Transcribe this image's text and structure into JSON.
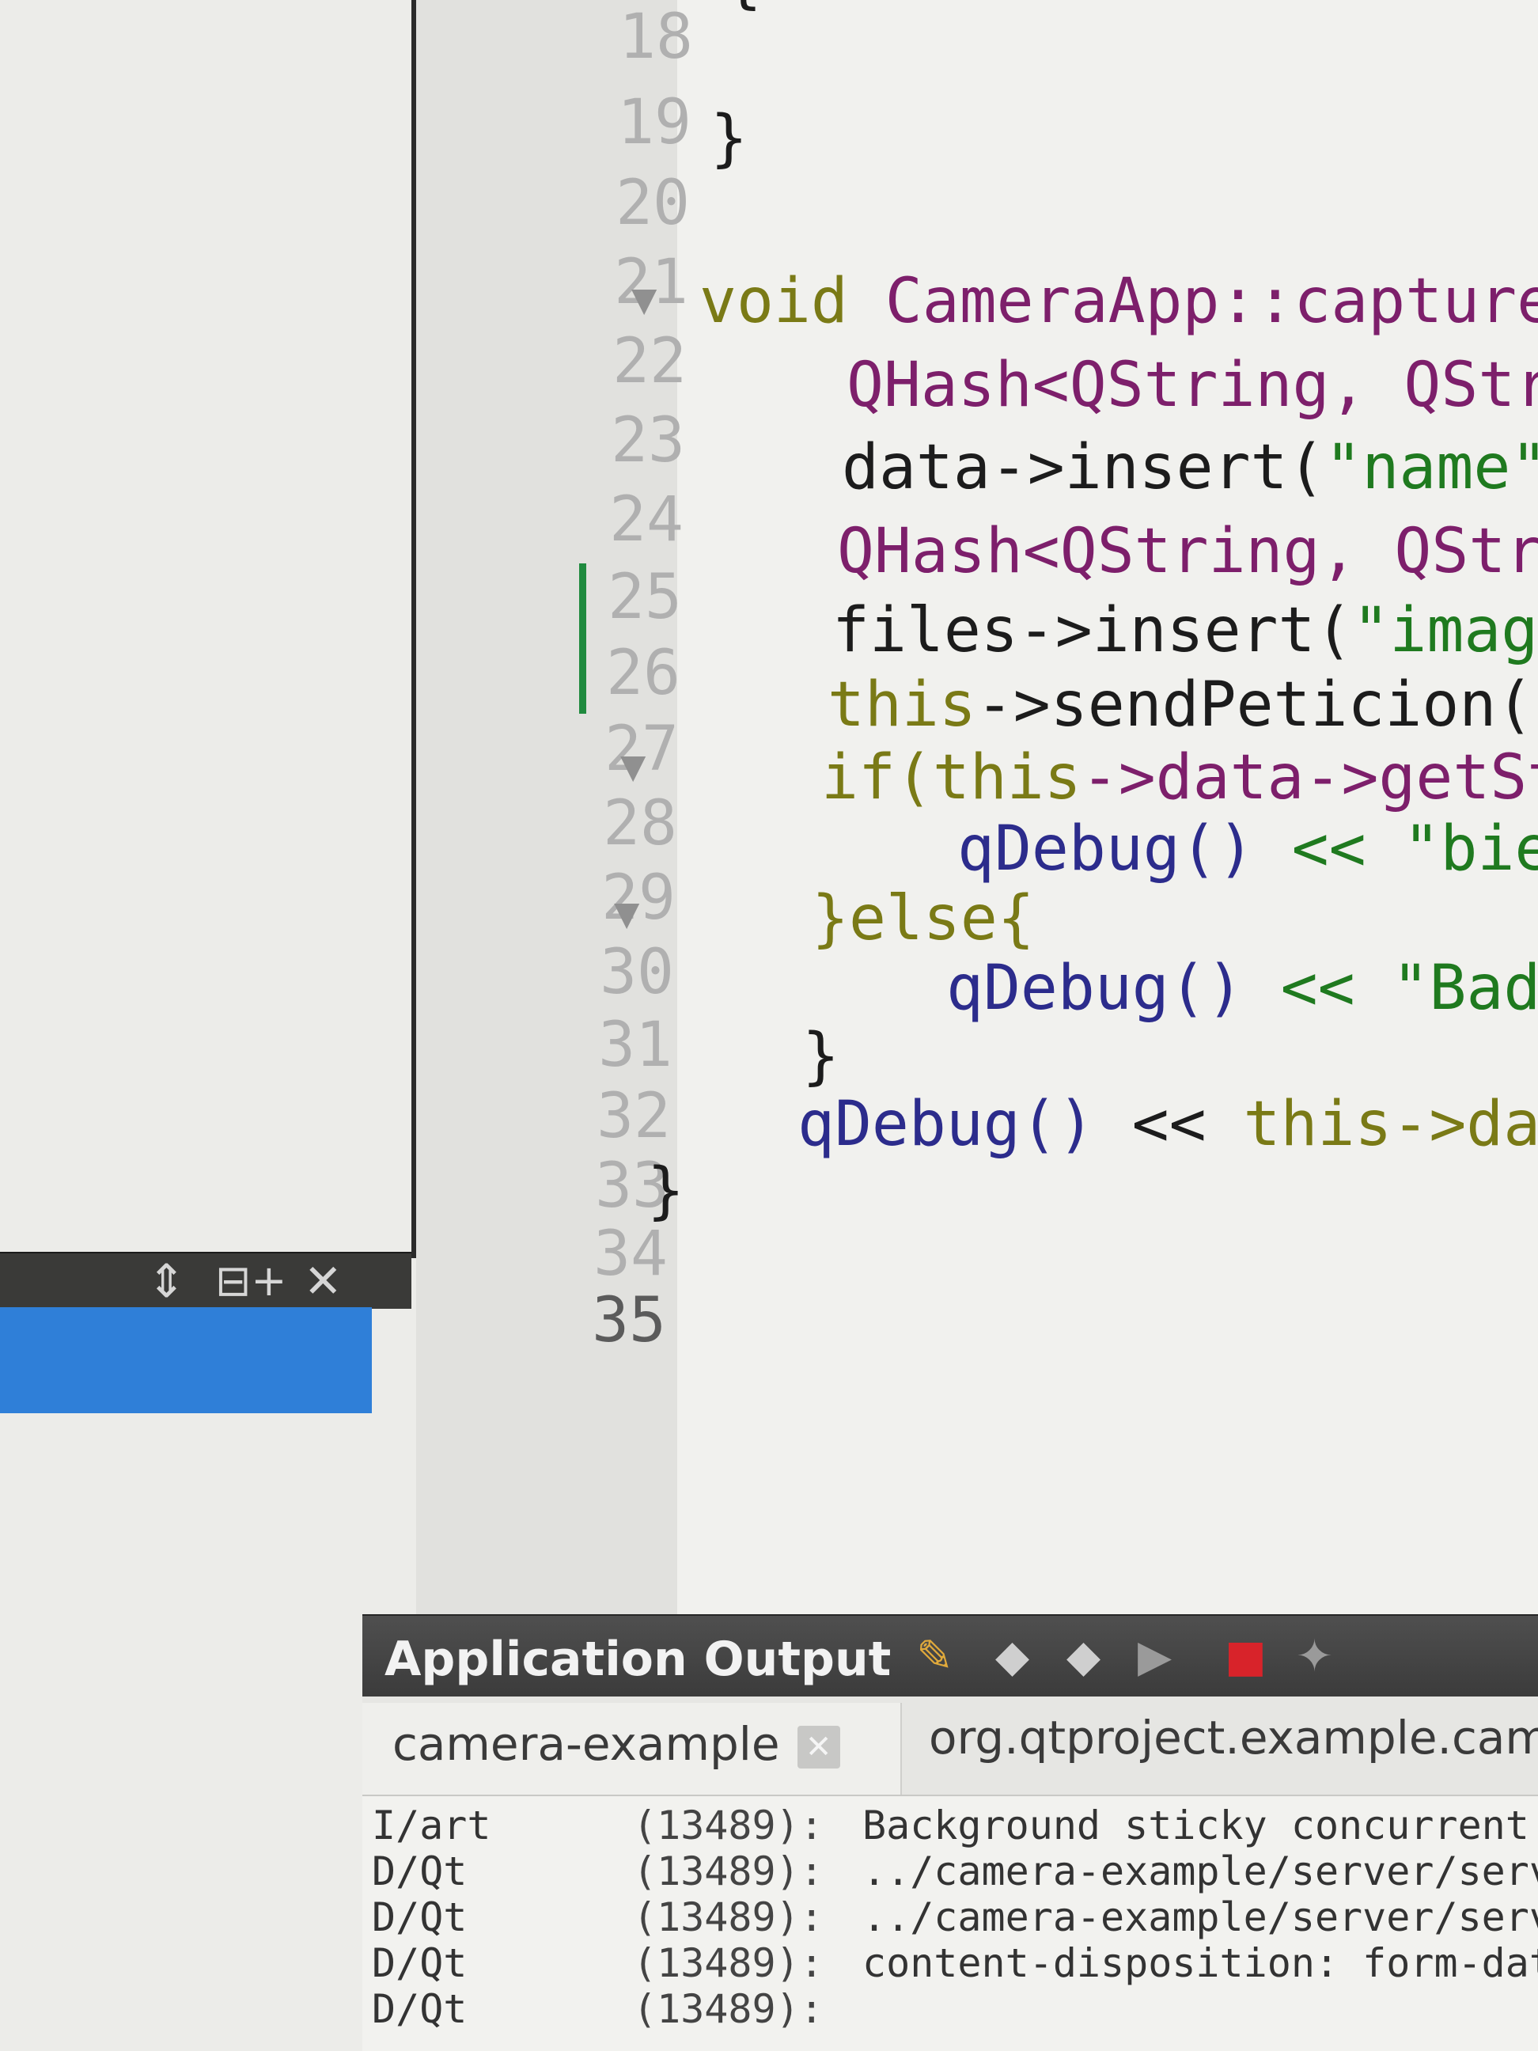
{
  "left_panel": {
    "toolbar_icons": [
      "updown-arrows-icon",
      "split-add-icon",
      "close-icon"
    ]
  },
  "editor": {
    "line_numbers": [
      "18",
      "19",
      "20",
      "21",
      "22",
      "23",
      "24",
      "25",
      "26",
      "27",
      "28",
      "29",
      "30",
      "31",
      "32",
      "33",
      "34",
      "35"
    ],
    "current_line": "35",
    "code": {
      "l18": "{",
      "l19": "}",
      "l21_kw": "void",
      "l21_rest": " CameraApp::capture",
      "l22_type": "QHash<QString, QStr",
      "l23_a": "data->insert(",
      "l23_b": "\"name\",",
      "l24_type": "QHash<QString, QStri",
      "l25_a": "files->insert(",
      "l25_b": "\"image",
      "l26_this": "this",
      "l26_rest": "->sendPeticion(\"",
      "l27_kw": "if(",
      "l27_this": "this",
      "l27_rest": "->data->getSta",
      "l28_fn": "qDebug()",
      "l28_rest": " << \"bien",
      "l29": "}else{",
      "l30_fn": "qDebug()",
      "l30_rest": " << \"Bad",
      "l31": "}",
      "l32_fn": "qDebug()",
      "l32_op": " << ",
      "l32_this": "this->data",
      "l33": "}"
    }
  },
  "output": {
    "title": "Application Output",
    "tabs": [
      {
        "label": "camera-example"
      },
      {
        "label": "org.qtproject.example.came"
      }
    ],
    "log": [
      {
        "tag": "I/art",
        "pid": "(13489):",
        "msg": "Background sticky concurrent"
      },
      {
        "tag": "D/Qt",
        "pid": "(13489):",
        "msg": "../camera-example/server/serv"
      },
      {
        "tag": "D/Qt",
        "pid": "(13489):",
        "msg": "../camera-example/server/serve"
      },
      {
        "tag": "D/Qt",
        "pid": "(13489):",
        "msg": "content-disposition: form-data"
      },
      {
        "tag": "D/Qt",
        "pid": "(13489):",
        "msg": ""
      }
    ]
  },
  "colors": {
    "selection": "#2f7fd8",
    "change_bar": "#1f8a3e",
    "stop": "#d8232a"
  }
}
